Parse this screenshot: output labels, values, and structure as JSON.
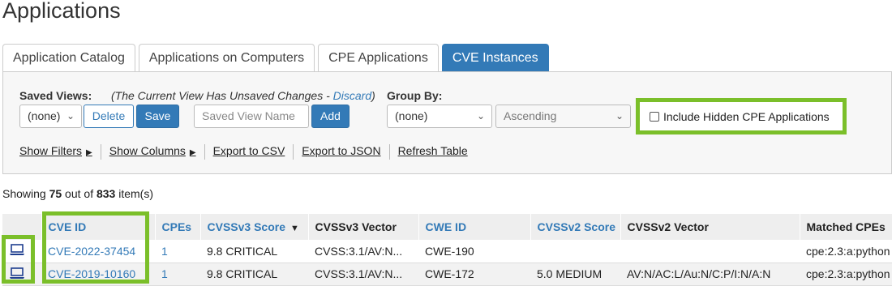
{
  "page": {
    "title": "Applications"
  },
  "tabs": [
    {
      "label": "Application Catalog",
      "active": false
    },
    {
      "label": "Applications on Computers",
      "active": false
    },
    {
      "label": "CPE Applications",
      "active": false
    },
    {
      "label": "CVE Instances",
      "active": true
    }
  ],
  "toolbar": {
    "saved_views_label": "Saved Views:",
    "unsaved_note": "(The Current View Has Unsaved Changes - ",
    "discard_label": "Discard",
    "unsaved_note_end": ")",
    "saved_view_value": "(none)",
    "delete_label": "Delete",
    "save_label": "Save",
    "view_name_placeholder": "Saved View Name",
    "add_label": "Add",
    "group_by_label": "Group By:",
    "group_by_value": "(none)",
    "order_value": "Ascending",
    "include_hidden_label": "Include Hidden CPE Applications",
    "include_hidden_checked": false,
    "links": {
      "show_filters": "Show Filters",
      "show_columns": "Show Columns",
      "export_csv": "Export to CSV",
      "export_json": "Export to JSON",
      "refresh": "Refresh Table"
    }
  },
  "summary": {
    "prefix": "Showing ",
    "shown": "75",
    "middle": " out of ",
    "total": "833",
    "suffix": " item(s)"
  },
  "table": {
    "headers": {
      "cve_id": "CVE ID",
      "cpes": "CPEs",
      "cvss3_score": "CVSSv3 Score",
      "cvss3_vector": "CVSSv3 Vector",
      "cwe_id": "CWE ID",
      "cvss2_score": "CVSSv2 Score",
      "cvss2_vector": "CVSSv2 Vector",
      "matched_cpes": "Matched CPEs"
    },
    "rows": [
      {
        "icon": "laptop-icon",
        "cve_id": "CVE-2022-37454",
        "cpes": "1",
        "cvss3_score": "9.8 CRITICAL",
        "cvss3_vector": "CVSS:3.1/AV:N...",
        "cwe_id": "CWE-190",
        "cvss2_score": "",
        "cvss2_vector": "",
        "matched_cpes": "cpe:2.3:a:python"
      },
      {
        "icon": "laptop-icon",
        "cve_id": "CVE-2019-10160",
        "cpes": "1",
        "cvss3_score": "9.8 CRITICAL",
        "cvss3_vector": "CVSS:3.1/AV:N...",
        "cwe_id": "CWE-172",
        "cvss2_score": "5.0 MEDIUM",
        "cvss2_vector": "AV:N/AC:L/Au:N/C:P/I:N/A:N",
        "matched_cpes": "cpe:2.3:a:python"
      }
    ]
  },
  "colors": {
    "accent": "#337ab7",
    "highlight": "#7bbf2a"
  }
}
